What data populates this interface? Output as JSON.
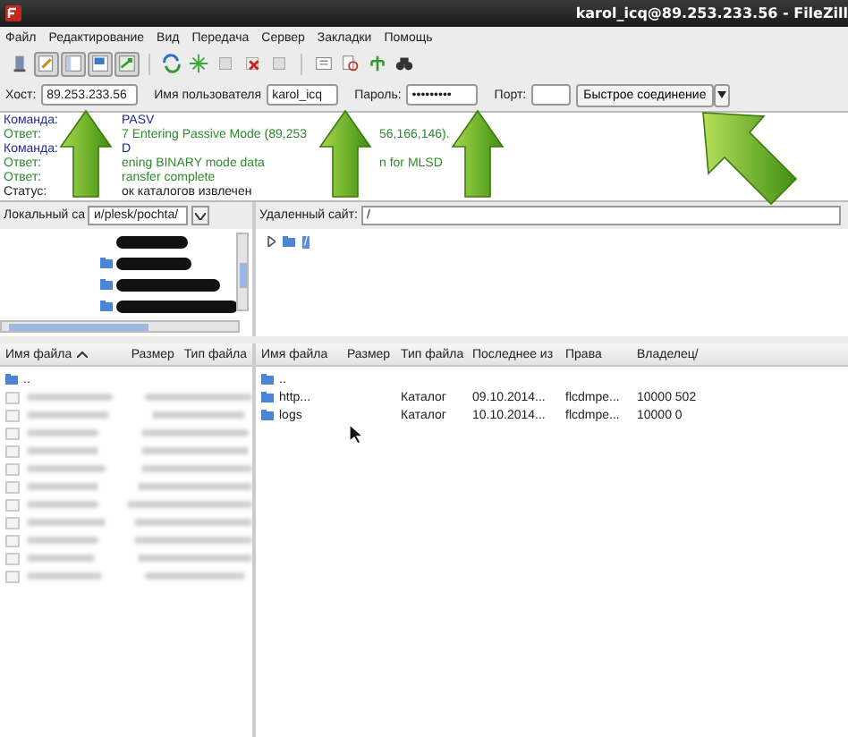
{
  "window": {
    "title": "karol_icq@89.253.233.56 - FileZill"
  },
  "menu": [
    "Файл",
    "Редактирование",
    "Вид",
    "Передача",
    "Сервер",
    "Закладки",
    "Помощь"
  ],
  "toolbar": [
    {
      "kind": "server",
      "pressed": false
    },
    {
      "kind": "pencil",
      "pressed": true
    },
    {
      "kind": "window",
      "pressed": true
    },
    {
      "kind": "remote",
      "pressed": true
    },
    {
      "kind": "queue",
      "pressed": true
    },
    {
      "kind": "refresh",
      "pressed": false
    },
    {
      "kind": "sparkle",
      "pressed": false
    },
    {
      "kind": "grey",
      "pressed": false
    },
    {
      "kind": "cancel",
      "pressed": false
    },
    {
      "kind": "grey",
      "pressed": false
    },
    {
      "kind": "list",
      "pressed": false
    },
    {
      "kind": "compare",
      "pressed": false
    },
    {
      "kind": "tree",
      "pressed": false
    },
    {
      "kind": "binoculars",
      "pressed": false
    }
  ],
  "quickconnect": {
    "host_label": "Хост:",
    "host": "89.253.233.56",
    "user_label": "Имя пользователя",
    "user": "karol_icq",
    "password_label": "Пароль:",
    "password": "•••••••••",
    "port_label": "Порт:",
    "connect_button": "Быстрое соединение"
  },
  "log": [
    {
      "kind": "command",
      "label": "Команда:",
      "segments": [
        "PASV"
      ]
    },
    {
      "kind": "response",
      "label": "Ответ:",
      "segments": [
        "7 Entering Passive Mode (89,253",
        "56,166,146)."
      ]
    },
    {
      "kind": "command",
      "label": "Команда:",
      "segments": [
        "D"
      ]
    },
    {
      "kind": "response",
      "label": "Ответ:",
      "segments": [
        "ening BINARY mode data",
        "n for MLSD"
      ]
    },
    {
      "kind": "response",
      "label": "Ответ:",
      "segments": [
        "ransfer complete"
      ]
    },
    {
      "kind": "status",
      "label": "Статус:",
      "segments": [
        "ок каталогов извлечен"
      ]
    }
  ],
  "annotations": [
    {
      "kind": "arrow-up"
    },
    {
      "kind": "arrow-up"
    },
    {
      "kind": "arrow-up"
    },
    {
      "kind": "arrow-up-left"
    }
  ],
  "local_site": {
    "label": "Локальный са",
    "path": "и/plesk/pochta/"
  },
  "local_tree": [
    {
      "kind": "redacted"
    },
    {
      "kind": "redacted"
    },
    {
      "kind": "redacted"
    },
    {
      "kind": "redacted"
    }
  ],
  "remote_site": {
    "label": "Удаленный сайт:",
    "path": "/"
  },
  "remote_tree": [
    {
      "label": "/",
      "selected": true,
      "expanded": false
    }
  ],
  "local_files": {
    "columns": [
      {
        "label": "Имя файла",
        "sorted": true
      },
      {
        "label": "Размер",
        "sorted": false
      },
      {
        "label": "Тип файла",
        "sorted": false
      }
    ],
    "rows": [
      {
        "kind": "folder",
        "name": ".."
      },
      {
        "kind": "blurred"
      },
      {
        "kind": "blurred"
      },
      {
        "kind": "blurred"
      },
      {
        "kind": "blurred"
      },
      {
        "kind": "blurred"
      },
      {
        "kind": "blurred"
      },
      {
        "kind": "blurred"
      },
      {
        "kind": "blurred"
      },
      {
        "kind": "blurred"
      },
      {
        "kind": "blurred"
      },
      {
        "kind": "blurred"
      }
    ]
  },
  "remote_files": {
    "columns": [
      {
        "label": "Имя файла"
      },
      {
        "label": "Размер"
      },
      {
        "label": "Тип файла"
      },
      {
        "label": "Последнее из"
      },
      {
        "label": "Права"
      },
      {
        "label": "Владелец/"
      }
    ],
    "rows": [
      {
        "kind": "folder",
        "cells": [
          "..",
          "",
          "",
          "",
          "",
          ""
        ]
      },
      {
        "kind": "folder",
        "cells": [
          "http...",
          "",
          "Каталог",
          "09.10.2014...",
          "flcdmpe...",
          "10000 502"
        ]
      },
      {
        "kind": "folder",
        "cells": [
          "logs",
          "",
          "Каталог",
          "10.10.2014...",
          "flcdmpe...",
          "10000 0"
        ]
      }
    ]
  }
}
